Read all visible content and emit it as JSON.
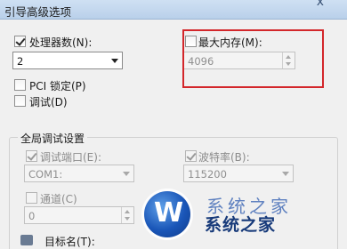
{
  "window": {
    "title": "引导高级选项",
    "close_glyph": "x"
  },
  "processors": {
    "label": "处理器数(N):",
    "checked": true,
    "value": "2"
  },
  "max_memory": {
    "label": "最大内存(M):",
    "checked": false,
    "value": "4096"
  },
  "pci_lock": {
    "label": "PCI 锁定(P)",
    "checked": false
  },
  "debug": {
    "label": "调试(D)",
    "checked": false
  },
  "global_debug": {
    "title": "全局调试设置",
    "debug_port": {
      "label": "调试端口(E):",
      "checked": true,
      "value": "COM1:"
    },
    "baud_rate": {
      "label": "波特率(B):",
      "checked": true,
      "value": "115200"
    },
    "channel": {
      "label": "通道(C)",
      "checked": false,
      "value": "0"
    },
    "target_name_label": "目标名(T):"
  },
  "watermark": {
    "brand_text": "系统之家",
    "ghost_text": "系统之家",
    "logo_letter": "W"
  },
  "colors": {
    "highlight_box": "#d3272b",
    "window_bg": "#f0f0f0"
  }
}
